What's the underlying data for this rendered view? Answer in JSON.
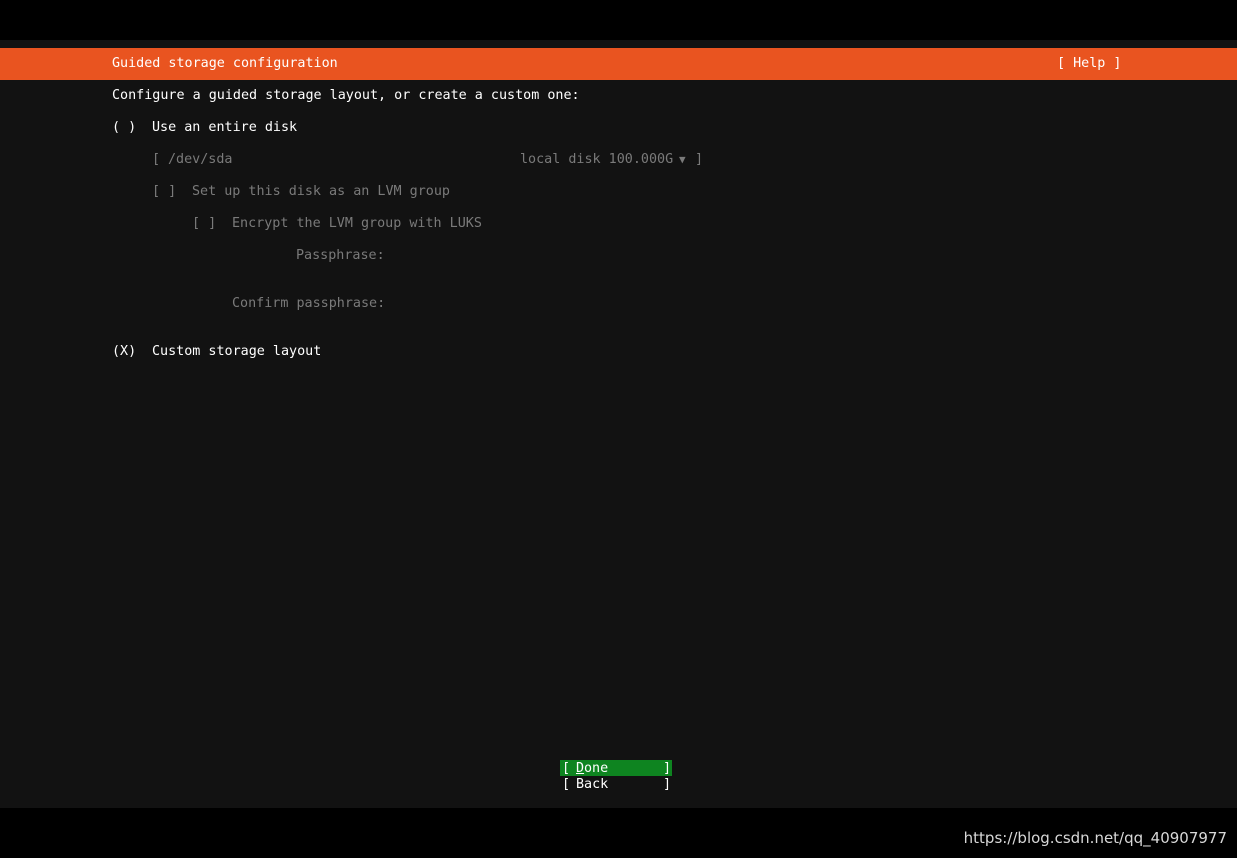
{
  "header": {
    "title": "Guided storage configuration",
    "help": "[ Help ]"
  },
  "intro": "Configure a guided storage layout, or create a custom one:",
  "entire_disk": {
    "radio": "( )",
    "label": "Use an entire disk",
    "disk_select": {
      "open_bracket": "[",
      "device": "/dev/sda",
      "description": "local disk 100.000G",
      "arrow": "▼",
      "close_bracket": "]"
    },
    "lvm": {
      "checkbox": "[ ]",
      "label": "Set up this disk as an LVM group"
    },
    "luks": {
      "checkbox": "[ ]",
      "label": "Encrypt the LVM group with LUKS"
    },
    "passphrase_label": "Passphrase:",
    "confirm_label": "Confirm passphrase:"
  },
  "custom_layout": {
    "radio": "(X)",
    "label": "Custom storage layout"
  },
  "buttons": {
    "done": {
      "open": "[ ",
      "hotkey": "D",
      "rest": "one",
      "close": "]"
    },
    "back": {
      "open": "[ ",
      "label": "Back",
      "close": "]"
    }
  },
  "watermark": "https://blog.csdn.net/qq_40907977"
}
